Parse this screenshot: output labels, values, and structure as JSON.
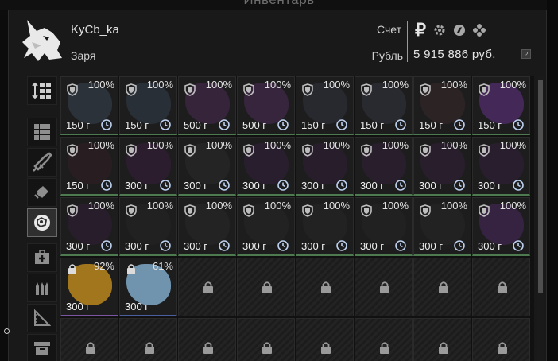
{
  "header": {
    "window_title": "Инвентарь",
    "nickname": "KyCb_ka",
    "side": "Заря",
    "account_label": "Счет",
    "currency_label": "Рубль",
    "money": "5 915 886 руб.",
    "help": "?",
    "currency_icons": [
      "ruble-icon",
      "gear-currency-icon",
      "compass-currency-icon",
      "flower-currency-icon"
    ]
  },
  "sidebar": [
    {
      "name": "sort-button",
      "icon": "sort-icon",
      "active": false
    },
    {
      "name": "category-all",
      "icon": "grid-icon",
      "active": false
    },
    {
      "name": "category-weapons",
      "icon": "rifle-icon",
      "active": false
    },
    {
      "name": "category-ammo",
      "icon": "ammo-box-icon",
      "active": false
    },
    {
      "name": "category-artifacts",
      "icon": "artifact-ball-icon",
      "active": true
    },
    {
      "name": "category-medical",
      "icon": "medkit-icon",
      "active": false
    },
    {
      "name": "category-cartridges",
      "icon": "cartridges-icon",
      "active": false
    },
    {
      "name": "category-tools",
      "icon": "ruler-icon",
      "active": false
    },
    {
      "name": "category-containers",
      "icon": "container-icon",
      "active": false
    }
  ],
  "items": [
    {
      "pct": "100%",
      "weight": "150 г",
      "color": "#2e3640"
    },
    {
      "pct": "100%",
      "weight": "150 г",
      "color": "#2b323b"
    },
    {
      "pct": "100%",
      "weight": "500 г",
      "color": "#3a2640"
    },
    {
      "pct": "100%",
      "weight": "500 г",
      "color": "#3b2742"
    },
    {
      "pct": "100%",
      "weight": "150 г",
      "color": "#2a2b32"
    },
    {
      "pct": "100%",
      "weight": "150 г",
      "color": "#2c2d34"
    },
    {
      "pct": "100%",
      "weight": "150 г",
      "color": "#2e2426"
    },
    {
      "pct": "100%",
      "weight": "150 г",
      "color": "#4a2a63"
    },
    {
      "pct": "100%",
      "weight": "150 г",
      "color": "#2a1f22"
    },
    {
      "pct": "100%",
      "weight": "300 г",
      "color": "#2e1d31"
    },
    {
      "pct": "100%",
      "weight": "300 г",
      "color": "#262626"
    },
    {
      "pct": "100%",
      "weight": "300 г",
      "color": "#2c1f30"
    },
    {
      "pct": "100%",
      "weight": "300 г",
      "color": "#2a1e2e"
    },
    {
      "pct": "100%",
      "weight": "300 г",
      "color": "#2b1e2e"
    },
    {
      "pct": "100%",
      "weight": "300 г",
      "color": "#2b1f2f"
    },
    {
      "pct": "100%",
      "weight": "300 г",
      "color": "#2c1f30"
    },
    {
      "pct": "100%",
      "weight": "300 г",
      "color": "#2a1d2d"
    },
    {
      "pct": "100%",
      "weight": "300 г",
      "color": "#222222"
    },
    {
      "pct": "100%",
      "weight": "300 г",
      "color": "#242424"
    },
    {
      "pct": "100%",
      "weight": "300 г",
      "color": "#232323"
    },
    {
      "pct": "100%",
      "weight": "300 г",
      "color": "#232323"
    },
    {
      "pct": "100%",
      "weight": "300 г",
      "color": "#222222"
    },
    {
      "pct": "100%",
      "weight": "300 г",
      "color": "#232323"
    },
    {
      "pct": "100%",
      "weight": "300 г",
      "color": "#3a2448"
    },
    {
      "pct": "92%",
      "weight": "300 г",
      "color": "#b8861c"
    },
    {
      "pct": "61%",
      "weight": "300 г",
      "color": "#7fa8c8"
    }
  ]
}
